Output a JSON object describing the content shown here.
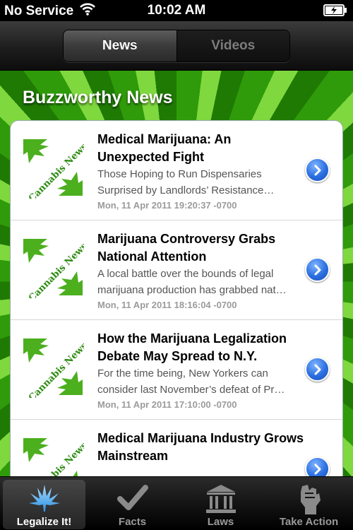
{
  "status_bar": {
    "carrier": "No Service",
    "time": "10:02 AM",
    "icons": [
      "wifi-icon",
      "battery-charging-icon"
    ]
  },
  "segmented_control": {
    "items": [
      {
        "label": "News",
        "selected": true
      },
      {
        "label": "Videos",
        "selected": false
      }
    ]
  },
  "section": {
    "title": "Buzzworthy News"
  },
  "thumbnail": {
    "label": "Cannabis News"
  },
  "news": [
    {
      "title": "Medical Marijuana: An Unexpected Fight",
      "description": "Those Hoping to Run Dispensaries Surprised by Landlords’ Resistance…",
      "date": "Mon, 11 Apr 2011 19:20:37 -0700"
    },
    {
      "title": "Marijuana Controversy Grabs National Attention",
      "description": "A local battle over the bounds of legal marijuana production has grabbed nat…",
      "date": "Mon, 11 Apr 2011 18:16:04 -0700"
    },
    {
      "title": "How the Marijuana Legalization Debate May Spread to N.Y.",
      "description": "For the time being, New Yorkers can consider last November’s defeat of Pr…",
      "date": "Mon, 11 Apr 2011 17:10:00 -0700"
    },
    {
      "title": "Medical Marijuana Industry Grows Mainstream",
      "description": "",
      "date": ""
    }
  ],
  "tab_bar": {
    "tabs": [
      {
        "label": "Legalize It!",
        "icon": "leaf-icon",
        "active": true
      },
      {
        "label": "Facts",
        "icon": "checkmark-icon",
        "active": false
      },
      {
        "label": "Laws",
        "icon": "courthouse-icon",
        "active": false
      },
      {
        "label": "Take Action",
        "icon": "raised-fist-icon",
        "active": false
      }
    ]
  },
  "colors": {
    "accent_blue": "#2a6fe0",
    "background_green": "#2f9b0a",
    "tab_active_text": "#ffffff",
    "tab_inactive_text": "#9a9a9a"
  }
}
